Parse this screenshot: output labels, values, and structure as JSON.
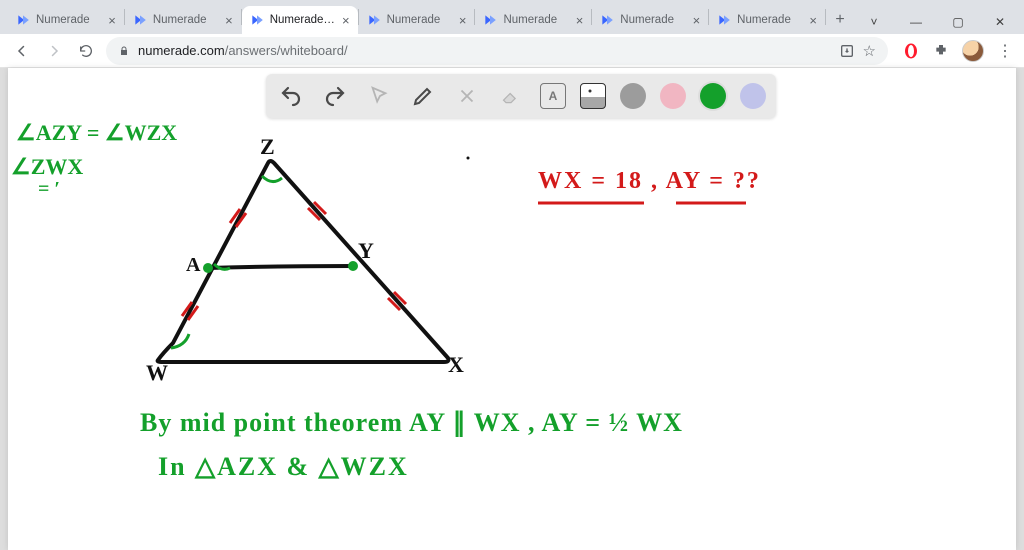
{
  "browser": {
    "tabs": [
      {
        "title": "Numerade"
      },
      {
        "title": "Numerade"
      },
      {
        "title": "Numerade Whiteboard"
      },
      {
        "title": "Numerade"
      },
      {
        "title": "Numerade"
      },
      {
        "title": "Numerade"
      },
      {
        "title": "Numerade"
      }
    ],
    "active_tab_index": 2,
    "window_controls": {
      "caret": "˅",
      "minimize": "—",
      "maximize": "▢",
      "close": "✕"
    },
    "new_tab_glyph": "+"
  },
  "address": {
    "host": "numerade.com",
    "path": "/answers/whiteboard/"
  },
  "whiteboard": {
    "toolbar": {
      "undo": "undo",
      "redo": "redo",
      "pointer": "pointer",
      "pen": "pen",
      "tools": "tools",
      "eraser": "eraser",
      "textbox_label": "A",
      "image": "image",
      "colors": [
        "#9c9c9c",
        "#f1b6c2",
        "#14a02b",
        "#c0c3ea"
      ],
      "active_color": "#14a02b"
    },
    "handwriting": {
      "eq_top1": "∠AZY = ∠WZX",
      "eq_top2": "∠ZWX",
      "eq_top2b": "= ′",
      "labels": {
        "Z": "Z",
        "A": "A",
        "Y": "Y",
        "W": "W",
        "X": "X"
      },
      "red_text": "WX = 18 ,   AY = ??",
      "line1": "By mid point theorem   AY ∥ WX ,   AY = ½ WX",
      "line2": "In △AZX & △WZX"
    }
  }
}
